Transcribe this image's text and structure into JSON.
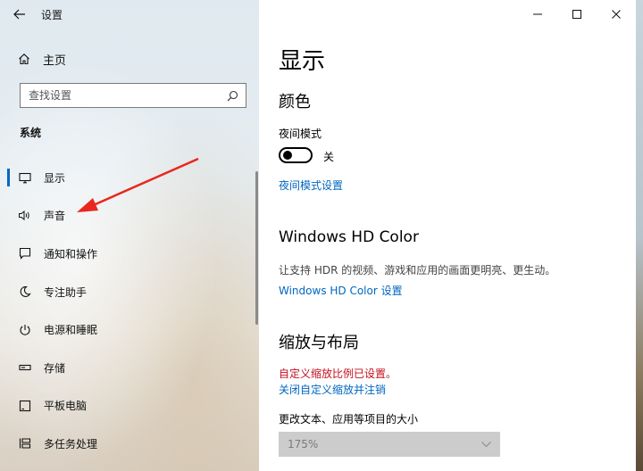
{
  "window": {
    "title": "设置",
    "controls": {
      "minimize": "minimize-icon",
      "maximize": "maximize-icon",
      "close": "close-icon"
    }
  },
  "sidebar": {
    "home_label": "主页",
    "search_placeholder": "查找设置",
    "section_label": "系统",
    "items": [
      {
        "label": "显示",
        "icon": "monitor-icon",
        "selected": true
      },
      {
        "label": "声音",
        "icon": "speaker-icon",
        "selected": false
      },
      {
        "label": "通知和操作",
        "icon": "notification-icon",
        "selected": false
      },
      {
        "label": "专注助手",
        "icon": "moon-icon",
        "selected": false
      },
      {
        "label": "电源和睡眠",
        "icon": "power-icon",
        "selected": false
      },
      {
        "label": "存储",
        "icon": "storage-icon",
        "selected": false
      },
      {
        "label": "平板电脑",
        "icon": "tablet-icon",
        "selected": false
      },
      {
        "label": "多任务处理",
        "icon": "multitask-icon",
        "selected": false
      }
    ]
  },
  "main": {
    "page_title": "显示",
    "color": {
      "heading": "颜色",
      "night_light_label": "夜间模式",
      "night_light_state": "关",
      "night_light_on": false,
      "night_light_settings_link": "夜间模式设置"
    },
    "hd_color": {
      "heading": "Windows HD Color",
      "description": "让支持 HDR 的视频、游戏和应用的画面更明亮、更生动。",
      "settings_link": "Windows HD Color 设置"
    },
    "scale_layout": {
      "heading": "缩放与布局",
      "warning": "自定义缩放比例已设置。",
      "turn_off_link": "关闭自定义缩放并注销",
      "scale_label": "更改文本、应用等项目的大小",
      "scale_value": "175%"
    }
  },
  "colors": {
    "accent": "#0067c0",
    "warning": "#c50f1f",
    "annotation_arrow": "#e8281e"
  }
}
